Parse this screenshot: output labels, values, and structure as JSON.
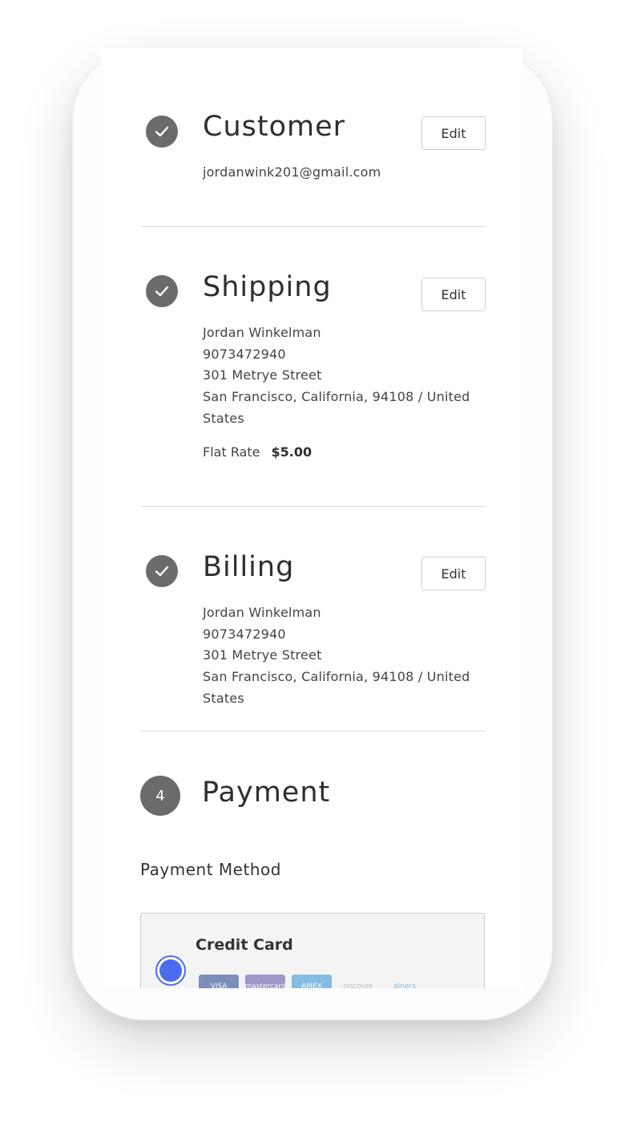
{
  "customer": {
    "title": "Customer",
    "edit_label": "Edit",
    "email": "jordanwink201@gmail.com"
  },
  "shipping": {
    "title": "Shipping",
    "edit_label": "Edit",
    "name": "Jordan Winkelman",
    "phone": "9073472940",
    "street": "301 Metrye Street",
    "city_line": "San Francisco, California, 94108 / United States",
    "method": "Flat Rate",
    "price": "$5.00"
  },
  "billing": {
    "title": "Billing",
    "edit_label": "Edit",
    "name": "Jordan Winkelman",
    "phone": "9073472940",
    "street": "301 Metrye Street",
    "city_line": "San Francisco, California, 94108 / United States"
  },
  "payment": {
    "step": "4",
    "title": "Payment",
    "method_label": "Payment Method",
    "option_label": "Credit Card",
    "card_icons": [
      "VISA",
      "mastercard",
      "AMEX",
      "DISCOVER",
      "diners"
    ]
  },
  "colors": {
    "check_bg": "#6b6b6b",
    "radio_accent": "#4a6df0"
  }
}
